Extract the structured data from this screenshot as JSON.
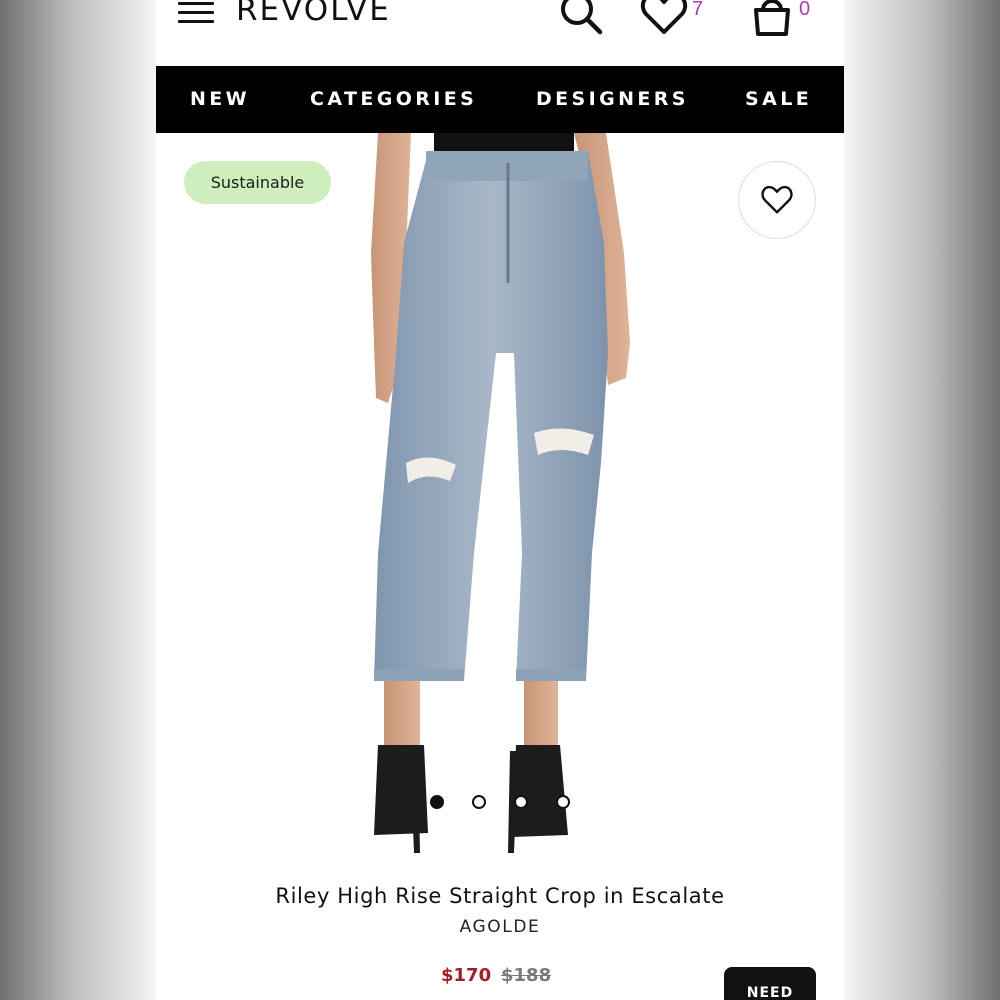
{
  "header": {
    "logo": "REVOLVE",
    "icons": [
      "menu-icon",
      "search-icon",
      "heart-icon",
      "bag-icon"
    ],
    "wishlist_count": "7",
    "bag_count": "0",
    "count_color": "#b03aa7"
  },
  "nav": {
    "items": [
      {
        "label": "NEW"
      },
      {
        "label": "CATEGORIES"
      },
      {
        "label": "DESIGNERS"
      },
      {
        "label": "SALE"
      }
    ]
  },
  "product": {
    "badge": "Sustainable",
    "badge_color": "#cfeebe",
    "image": "product-photo: model wearing light-wash distressed cropped straight jeans with black heels",
    "gallery_current": 1,
    "gallery_total": 4,
    "title": "Riley High Rise Straight Crop in Escalate",
    "brand": "AGOLDE",
    "price_sale": "$170",
    "price_original": "$188",
    "sale_color": "#a11f24",
    "cta_label": "NEED"
  }
}
